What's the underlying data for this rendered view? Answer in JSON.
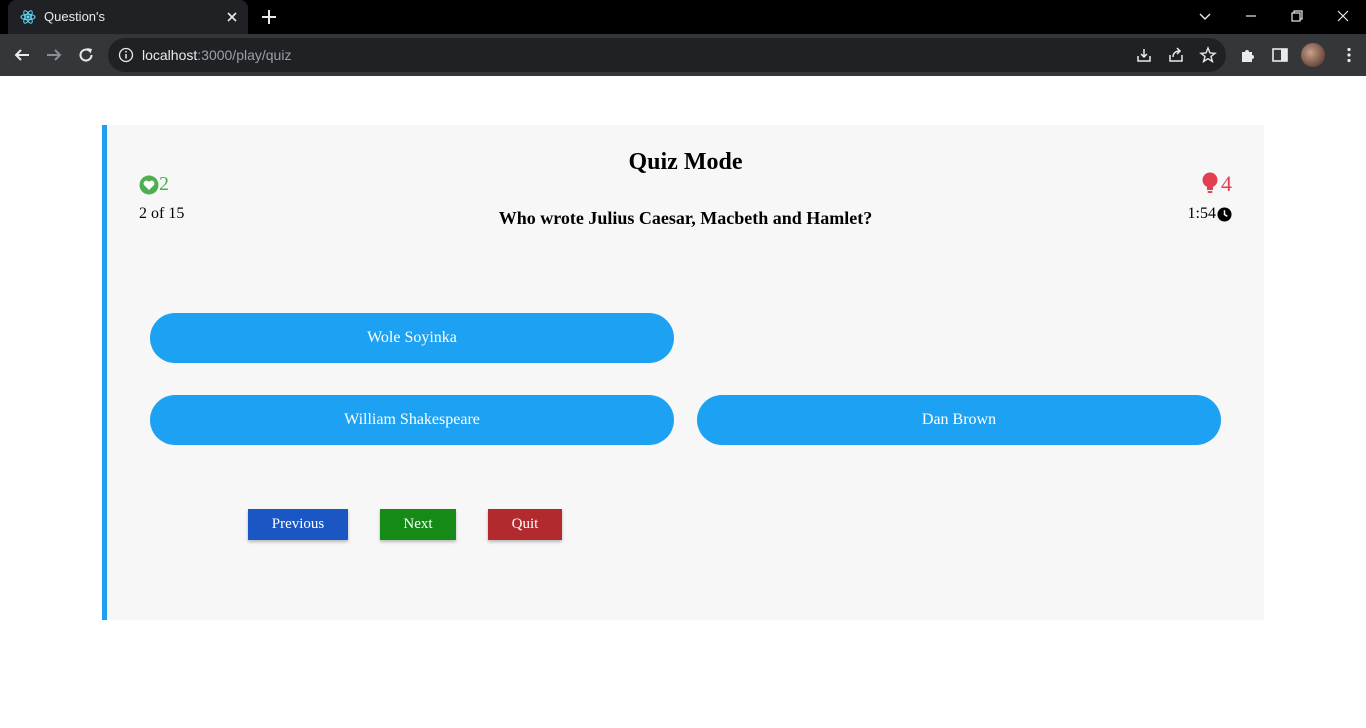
{
  "browser": {
    "tab_title": "Question's",
    "url_host": "localhost",
    "url_rest": ":3000/play/quiz"
  },
  "quiz": {
    "title": "Quiz Mode",
    "fifty_fifty_count": "2",
    "hints_count": "4",
    "question_progress": "2 of 15",
    "timer": "1:54",
    "question": "Who wrote Julius Caesar, Macbeth and Hamlet?",
    "options": [
      "Wole Soyinka",
      "William Shakespeare",
      "Dan Brown"
    ],
    "buttons": {
      "previous": "Previous",
      "next": "Next",
      "quit": "Quit"
    }
  },
  "colors": {
    "accent": "#1f9ff0",
    "option_bg": "#1da1f2",
    "lifeline_green": "#4caf50",
    "hint_red": "#e0404f",
    "previous_bg": "#1a56c4",
    "next_bg": "#158a16",
    "quit_bg": "#b22a2e"
  },
  "icons": [
    "react-favicon-icon",
    "heart-icon",
    "lightbulb-icon",
    "clock-icon"
  ]
}
